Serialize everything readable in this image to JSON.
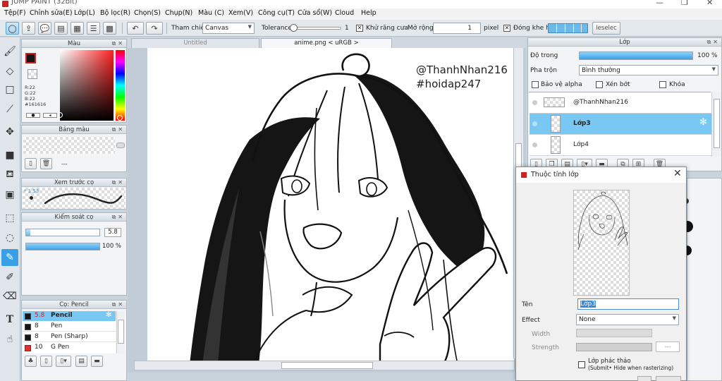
{
  "window": {
    "title": "JUMP PAINT (32bit)",
    "controls": [
      "—",
      "❐",
      "✕"
    ]
  },
  "menu": [
    "Tệp(F)",
    "Chỉnh sửa(E)",
    "Lớp(L)",
    "Bộ lọc(R)",
    "Chọn(S)",
    "Chụp(N)",
    "Màu (C)",
    "Xem(V)",
    "Công cụ(T)",
    "Cửa sổ(W)",
    "Cloud",
    "Help"
  ],
  "toolbar": {
    "reference_label": "Tham chiếu",
    "reference_value": "Canvas",
    "tolerance_label": "Tolerance",
    "tolerance_value": "1",
    "antialias_label": "Khử răng cưa",
    "antialias_checked": "✕",
    "expand_label": "Mở rộng",
    "expand_value": "1",
    "expand_unit": "pixel",
    "close_gap_checked": "✕",
    "close_gap_label": "Đóng khe hở",
    "deselect_label": "Ieselec"
  },
  "color_panel": {
    "title": "Màu",
    "readout": [
      "R:22",
      "G:22",
      "B:22",
      "#161616"
    ],
    "primary_color": "#161616"
  },
  "swatch_panel": {
    "title": "Bảng màu",
    "dashes": "---"
  },
  "preview_panel": {
    "title": "Xem trước cọ",
    "size": "1.53"
  },
  "brush_control": {
    "title": "Kiểm soát cọ",
    "size_value": "5.8",
    "opacity_value": "100 %",
    "size_fraction": 0.06,
    "opacity_fraction": 1.0
  },
  "brush_list": {
    "title": "Cọ: Pencil",
    "items": [
      {
        "size": "5.8",
        "name": "Pencil",
        "color": "#161616",
        "selected": true
      },
      {
        "size": "8",
        "name": "Pen",
        "color": "#161616",
        "selected": false
      },
      {
        "size": "8",
        "name": "Pen (Sharp)",
        "color": "#161616",
        "selected": false
      },
      {
        "size": "10",
        "name": "G Pen",
        "color": "#e03030",
        "selected": false
      }
    ]
  },
  "canvas": {
    "tabs": [
      "Untitled",
      "anime.png < uRGB >"
    ],
    "watermark_1": "@ThanhNhan216",
    "watermark_2": "#hoidap247"
  },
  "layer_panel": {
    "title": "Lớp",
    "opacity_label": "Độ trong",
    "opacity_value": "100 %",
    "opacity_fraction": 1.0,
    "blend_label": "Pha trộn",
    "blend_value": "Bình thường",
    "protect_alpha": "Bảo vệ alpha",
    "clipping": "Xén bớt",
    "lock": "Khóa",
    "layers": [
      {
        "name": "@ThanhNhan216",
        "selected": false
      },
      {
        "name": "Lớp3",
        "selected": true
      },
      {
        "name": "Lớp4",
        "selected": false
      }
    ]
  },
  "layer_dialog": {
    "title": "Thuộc tính lớp",
    "name_label": "Tên",
    "name_value": "Lớp3",
    "effect_label": "Effect",
    "effect_value": "None",
    "width_label": "Width",
    "strength_label": "Strength",
    "strength_value": "---",
    "sketch_label": "Lớp phác thảo",
    "sketch_note": "(Submit• Hide when rasterizing)"
  }
}
